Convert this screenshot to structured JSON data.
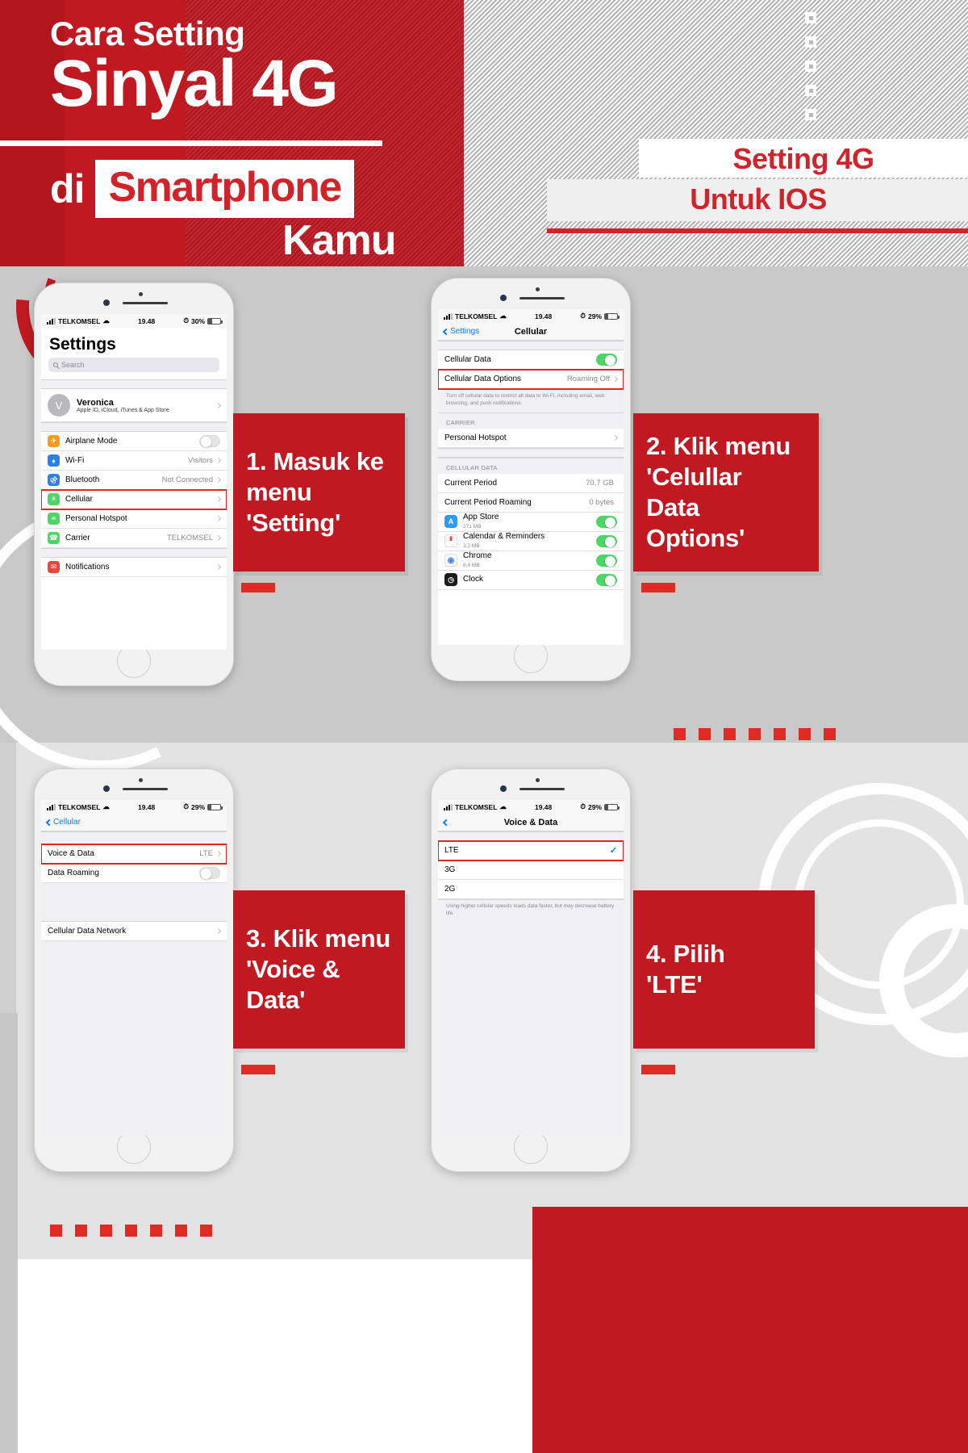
{
  "header": {
    "title_line1": "Cara Setting",
    "title_line2": "Sinyal 4G",
    "title_di": "di",
    "title_smartphone": "Smartphone",
    "title_kamu": "Kamu",
    "badge_line1": "Setting 4G",
    "badge_line2": "Untuk IOS",
    "accent_red": "#c01922",
    "accent_red_bright": "#e02a24"
  },
  "callouts": [
    {
      "id": "step1",
      "text": "1. Masuk ke\nmenu\n'Setting'"
    },
    {
      "id": "step2",
      "text": "2. Klik menu\n'Celullar\nData\nOptions'"
    },
    {
      "id": "step3",
      "text": "3. Klik menu\n'Voice &\nData'"
    },
    {
      "id": "step4",
      "text": "4. Pilih\n'LTE'"
    }
  ],
  "phone1": {
    "status": {
      "carrier": "TELKOMSEL",
      "time": "19.48",
      "battery": "30%"
    },
    "title": "Settings",
    "search_placeholder": "Search",
    "account": {
      "initial": "V",
      "name": "Veronica",
      "subtitle": "Apple ID, iCloud, iTunes & App Store"
    },
    "rows": [
      {
        "label": "Airplane Mode",
        "value": "",
        "control": "toggle-off",
        "icon": "airplane-icon",
        "icon_color": "#f79a1f"
      },
      {
        "label": "Wi-Fi",
        "value": "Visitors",
        "control": "chevron",
        "icon": "wifi-icon",
        "icon_color": "#2d7ff0"
      },
      {
        "label": "Bluetooth",
        "value": "Not Connected",
        "control": "chevron",
        "icon": "bluetooth-icon",
        "icon_color": "#2d7ff0"
      },
      {
        "label": "Cellular",
        "value": "",
        "control": "chevron",
        "icon": "cellular-icon",
        "icon_color": "#4cd764",
        "highlight": true
      },
      {
        "label": "Personal Hotspot",
        "value": "",
        "control": "chevron",
        "icon": "hotspot-icon",
        "icon_color": "#4cd764"
      },
      {
        "label": "Carrier",
        "value": "TELKOMSEL",
        "control": "chevron",
        "icon": "carrier-icon",
        "icon_color": "#4cd764"
      }
    ],
    "rows2": [
      {
        "label": "Notifications",
        "value": "",
        "control": "chevron",
        "icon": "notifications-icon",
        "icon_color": "#e8453c"
      }
    ]
  },
  "phone2": {
    "status": {
      "carrier": "TELKOMSEL",
      "time": "19.48",
      "battery": "29%"
    },
    "nav_back": "Settings",
    "nav_title": "Cellular",
    "rows_top": [
      {
        "label": "Cellular Data",
        "value": "",
        "control": "toggle-on"
      },
      {
        "label": "Cellular Data Options",
        "value": "Roaming Off",
        "control": "chevron",
        "highlight": true
      }
    ],
    "footnote": "Turn off cellular data to restrict all data to Wi-Fi, including email, web browsing, and push notifications.",
    "section_carrier": "CARRIER",
    "rows_carrier": [
      {
        "label": "Personal Hotspot",
        "value": "",
        "control": "chevron"
      }
    ],
    "section_data": "CELLULAR DATA",
    "rows_data": [
      {
        "label": "Current Period",
        "value": "70,7 GB",
        "control": "none"
      },
      {
        "label": "Current Period Roaming",
        "value": "0 bytes",
        "control": "none"
      }
    ],
    "apps": [
      {
        "name": "App Store",
        "size": "271 MB",
        "icon": "appstore-icon",
        "icon_color": "#2d9bf0",
        "glyph": "A",
        "toggle": "on"
      },
      {
        "name": "Calendar & Reminders",
        "size": "3,2 MB",
        "icon": "calendar-icon",
        "icon_color": "#ffffff",
        "glyph": "",
        "toggle": "on"
      },
      {
        "name": "Chrome",
        "size": "8,4 MB",
        "icon": "chrome-icon",
        "icon_color": "#ffffff",
        "glyph": "",
        "toggle": "on"
      },
      {
        "name": "Clock",
        "size": "",
        "icon": "clock-icon",
        "icon_color": "#1c1c1e",
        "glyph": "",
        "toggle": "on"
      }
    ]
  },
  "phone3": {
    "status": {
      "carrier": "TELKOMSEL",
      "time": "19.48",
      "battery": "29%"
    },
    "nav_back": "Cellular",
    "rows_top": [
      {
        "label": "Voice & Data",
        "value": "LTE",
        "control": "chevron",
        "highlight": true
      },
      {
        "label": "Data Roaming",
        "value": "",
        "control": "toggle-off"
      }
    ],
    "rows_bottom": [
      {
        "label": "Cellular Data Network",
        "value": "",
        "control": "chevron"
      }
    ]
  },
  "phone4": {
    "status": {
      "carrier": "TELKOMSEL",
      "time": "19.48",
      "battery": "29%"
    },
    "nav_back": "",
    "nav_title": "Voice & Data",
    "options": [
      {
        "label": "LTE",
        "selected": true,
        "highlight": true
      },
      {
        "label": "3G",
        "selected": false
      },
      {
        "label": "2G",
        "selected": false
      }
    ],
    "footnote": "Using higher cellular speeds loads data faster, but may decrease battery life."
  }
}
